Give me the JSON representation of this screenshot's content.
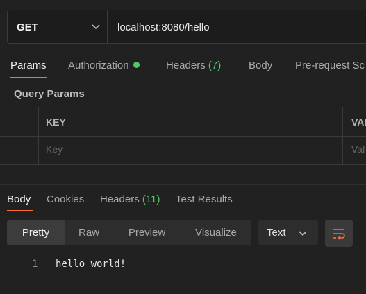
{
  "request": {
    "method": "GET",
    "url": "localhost:8080/hello"
  },
  "request_tabs": [
    {
      "label": "Params"
    },
    {
      "label": "Authorization"
    },
    {
      "label": "Headers",
      "count": "(7)"
    },
    {
      "label": "Body"
    },
    {
      "label": "Pre-request Sc"
    }
  ],
  "query_params": {
    "title": "Query Params",
    "columns": [
      "KEY",
      "VAL"
    ],
    "placeholders": {
      "key": "Key",
      "value": "Val"
    }
  },
  "response_tabs": [
    {
      "label": "Body"
    },
    {
      "label": "Cookies"
    },
    {
      "label": "Headers",
      "count": "(11)"
    },
    {
      "label": "Test Results"
    }
  ],
  "view_modes": [
    "Pretty",
    "Raw",
    "Preview",
    "Visualize"
  ],
  "format": "Text",
  "response_body": {
    "line_number": "1",
    "content": "hello world!"
  },
  "colors": {
    "accent": "#ff6c37",
    "status_green": "#51c768",
    "background": "#212121"
  },
  "icons": [
    "chevron-down-icon",
    "wrap-lines-icon"
  ]
}
